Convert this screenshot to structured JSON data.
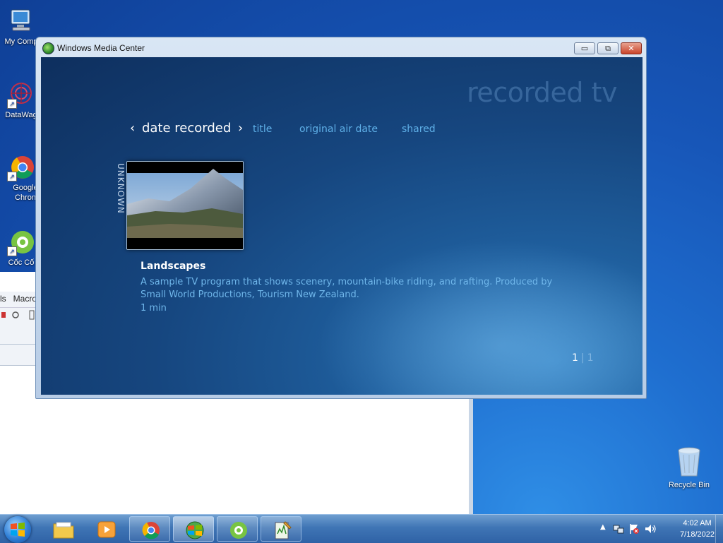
{
  "desktop": {
    "icons": [
      {
        "label": "My Comp"
      },
      {
        "label": "DataWag"
      },
      {
        "label": "Google Chron"
      },
      {
        "label": "Cốc Cố"
      }
    ],
    "recycle_bin": "Recycle Bin"
  },
  "background_window": {
    "menu": [
      "ls",
      "Macro"
    ]
  },
  "media_center": {
    "window_title": "Windows Media Center",
    "buttons": {
      "minimize": "▭",
      "restore": "⧉",
      "close": "✕"
    },
    "heading": "recorded tv",
    "nav": {
      "active": "date recorded",
      "left_chevron": "‹",
      "right_chevron": "›",
      "items": [
        "title",
        "original air date",
        "shared"
      ]
    },
    "group_label": "UNKNOWN",
    "program": {
      "title": "Landscapes",
      "description": "A sample TV program that shows scenery, mountain-bike riding, and rafting. Produced by Small World Productions, Tourism New Zealand.",
      "duration": "1 min"
    },
    "pager": {
      "current": "1",
      "separator": "|",
      "total": "1"
    }
  },
  "taskbar": {
    "clock": {
      "time": "4:02 AM",
      "date": "7/18/2022"
    }
  }
}
